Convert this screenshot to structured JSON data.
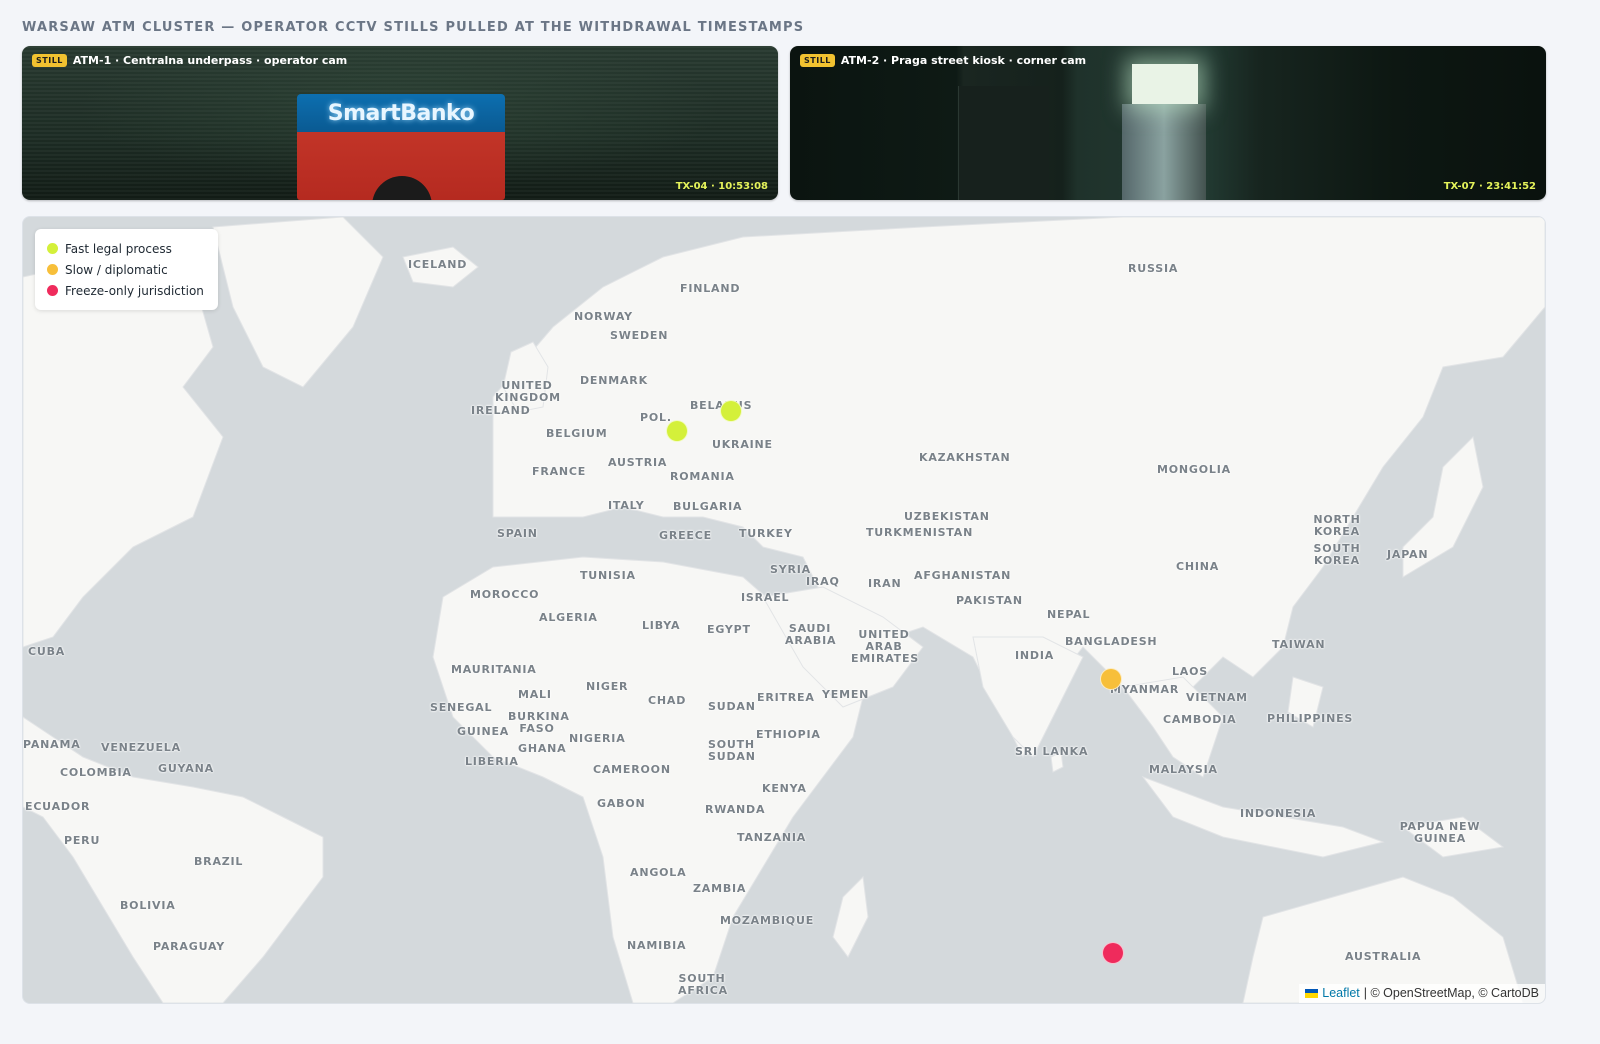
{
  "page": {
    "title": "WARSAW ATM CLUSTER — OPERATOR CCTV STILLS PULLED AT THE WITHDRAWAL TIMESTAMPS"
  },
  "cams": [
    {
      "badge": "STILL",
      "label": "ATM-1 · Centralna underpass · operator cam",
      "timestamp": "TX-04 · 10:53:08",
      "sign_text": "SmartBanko"
    },
    {
      "badge": "STILL",
      "label": "ATM-2 · Praga street kiosk · corner cam",
      "timestamp": "TX-07 · 23:41:52"
    }
  ],
  "legend": {
    "items": [
      {
        "label": "Fast legal process",
        "color": "#d4f03a"
      },
      {
        "label": "Slow / diplomatic",
        "color": "#f7bf3a"
      },
      {
        "label": "Freeze-only jurisdiction",
        "color": "#ef2b5c"
      }
    ]
  },
  "map": {
    "labels": [
      "ICELAND",
      "FINLAND",
      "NORWAY",
      "SWEDEN",
      "RUSSIA",
      "DENMARK",
      "UNITED KINGDOM",
      "IRELAND",
      "BELARUS",
      "POL.",
      "BELGIUM",
      "UKRAINE",
      "FRANCE",
      "AUSTRIA",
      "KAZAKHSTAN",
      "MONGOLIA",
      "ROMANIA",
      "ITALY",
      "BULGARIA",
      "UZBEKISTAN",
      "SPAIN",
      "GREECE",
      "TURKEY",
      "TURKMENISTAN",
      "NORTH KOREA",
      "SOUTH KOREA",
      "JAPAN",
      "TUNISIA",
      "SYRIA",
      "IRAQ",
      "IRAN",
      "AFGHANISTAN",
      "CHINA",
      "MOROCCO",
      "ISRAEL",
      "PAKISTAN",
      "ALGERIA",
      "LIBYA",
      "EGYPT",
      "SAUDI ARABIA",
      "UNITED ARAB EMIRATES",
      "NEPAL",
      "BANGLADESH",
      "INDIA",
      "TAIWAN",
      "CUBA",
      "MAURITANIA",
      "MALI",
      "NIGER",
      "CHAD",
      "SUDAN",
      "ERITREA",
      "YEMEN",
      "LAOS",
      "MYANMAR",
      "VIETNAM",
      "SENEGAL",
      "BURKINA FASO",
      "GUINEA",
      "NIGERIA",
      "ETHIOPIA",
      "CAMBODIA",
      "PHILIPPINES",
      "PANAMA",
      "VENEZUELA",
      "GHANA",
      "SOUTH SUDAN",
      "SRI LANKA",
      "COLOMBIA",
      "GUYANA",
      "LIBERIA",
      "CAMEROON",
      "MALAYSIA",
      "KENYA",
      "ECUADOR",
      "GABON",
      "RWANDA",
      "INDONESIA",
      "PERU",
      "TANZANIA",
      "PAPUA NEW GUINEA",
      "BRAZIL",
      "ANGOLA",
      "ZAMBIA",
      "BOLIVIA",
      "MOZAMBIQUE",
      "NAMIBIA",
      "PARAGUAY",
      "AUSTRALIA",
      "SOUTH AFRICA"
    ],
    "markers": [
      {
        "category": "fast",
        "color": "#d4f03a",
        "lat": 54.3,
        "lon": 25.3
      },
      {
        "category": "fast",
        "color": "#d4f03a",
        "lat": 52.2,
        "lon": 21.0
      },
      {
        "category": "slow",
        "color": "#f7bf3a",
        "lat": 25.2,
        "lon": 55.3
      },
      {
        "category": "freeze",
        "color": "#ef2b5c",
        "lat": -4.6,
        "lon": 55.5
      }
    ],
    "attribution": {
      "leaflet": "Leaflet",
      "rest": "| © OpenStreetMap, © CartoDB"
    }
  }
}
